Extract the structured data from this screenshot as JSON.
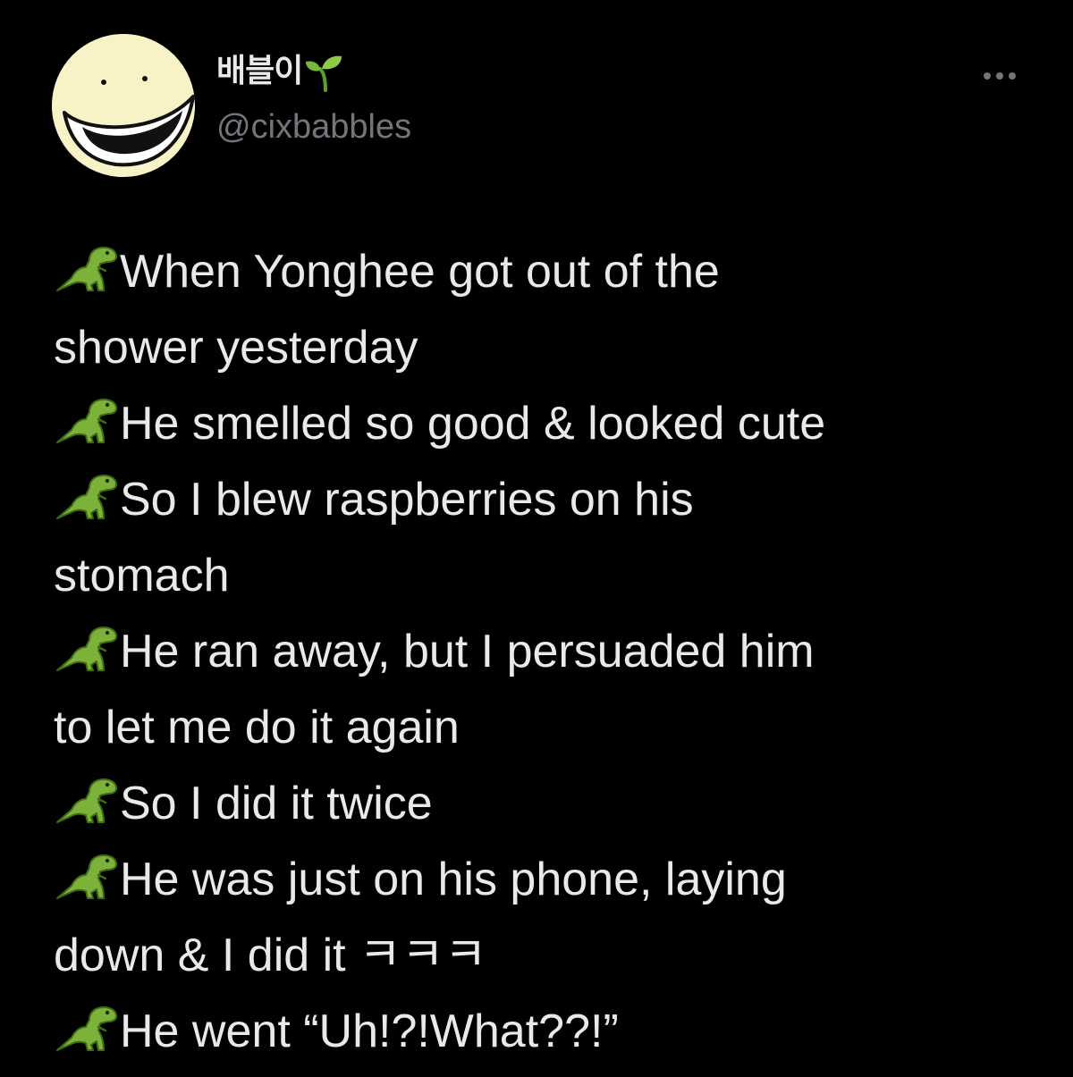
{
  "tweet": {
    "author": {
      "display_name": "배블이",
      "name_emoji": "sprout-icon",
      "handle": "@cixbabbles",
      "avatar": "smiley-face-avatar"
    },
    "more_icon": "ellipsis-icon",
    "bullet_icon": "t-rex-icon",
    "lines": [
      {
        "bullet": true,
        "text": "When Yonghee got out of the"
      },
      {
        "bullet": false,
        "text": "shower yesterday"
      },
      {
        "bullet": true,
        "text": "He smelled so good & looked cute"
      },
      {
        "bullet": true,
        "text": "So I blew raspberries on his"
      },
      {
        "bullet": false,
        "text": "stomach"
      },
      {
        "bullet": true,
        "text": "He ran away, but I persuaded him"
      },
      {
        "bullet": false,
        "text": "to let me do it again"
      },
      {
        "bullet": true,
        "text": "So I did it twice"
      },
      {
        "bullet": true,
        "text": "He was just on his phone, laying"
      },
      {
        "bullet": false,
        "text": "down & I did it ㅋㅋㅋ"
      },
      {
        "bullet": true,
        "text": "He went “Uh!?!What??!”"
      }
    ]
  },
  "colors": {
    "background": "#000000",
    "primary_text": "#e7e9ea",
    "secondary_text": "#71767b",
    "avatar_bg": "#f8f3c6",
    "dino_green": "#7db23a"
  }
}
